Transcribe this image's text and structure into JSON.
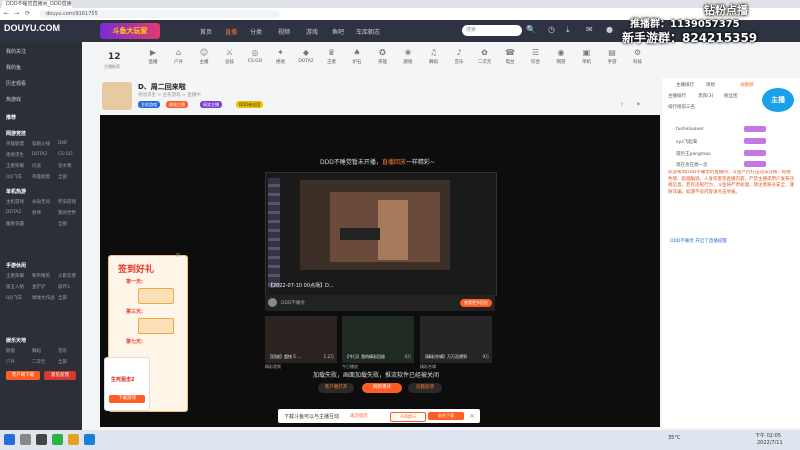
{
  "browser": {
    "tab_title": "DDD不睡觉直播间_DDD直播视频_斗鱼直播",
    "url": "douyu.com/9161755",
    "back": "←",
    "forward": "→",
    "refresh": "⟳"
  },
  "header": {
    "logo": "DOUYU.COM",
    "logo_sub": "斗鱼",
    "banner": "斗鱼大玩家",
    "nav": [
      "首页",
      "直播",
      "分类",
      "视频",
      "游戏",
      "鱼吧",
      "车库朝志"
    ],
    "active_nav": "直播",
    "search_placeholder": "搜索"
  },
  "sidebar": {
    "top_items": [
      "我的关注",
      "我的鱼",
      "历史观看",
      "热游戏"
    ],
    "recommend_label": "推荐",
    "sections": [
      {
        "title": "网游竞技",
        "cells": [
          "英雄联盟",
          "英雄联盟",
          "穿越火线",
          "DNF",
          "绝地求生",
          "DOTA2",
          "CS:GO",
          "王者荣耀",
          "问道",
          "逆水寒",
          "QQ飞车",
          "全部"
        ]
      },
      {
        "title": "单机热游",
        "cells": [
          "主机游戏",
          "永劫无间",
          "怀旧游戏",
          "DOTA2",
          "原神",
          "我的世界",
          "魔兽争霸",
          "全部"
        ]
      },
      {
        "title": "手游休闲",
        "cells": [
          "王者荣耀",
          "和平精英",
          "火影忍者",
          "第五人格",
          "金铲铲",
          "崩坏3",
          "QQ飞车",
          "球球大作战",
          "全部"
        ]
      },
      {
        "title": "娱乐天地",
        "cells": [
          "颜值",
          "舞蹈",
          "音乐",
          "户外",
          "二次元",
          "全部"
        ]
      },
      {
        "title": "科技文化",
        "cells": [
          "科技",
          "数码",
          "全部"
        ]
      }
    ],
    "btn_client": "客户端下载",
    "btn_feedback": "意见反馈"
  },
  "top_stats": {
    "count": "12",
    "label": "主播推荐"
  },
  "categories": [
    "直播",
    "户外",
    "主播",
    "竞技",
    "CS:GO",
    "绝地",
    "DOTA2",
    "王者",
    "炉石",
    "英雄",
    "颜值",
    "舞蹈",
    "音乐",
    "二次元",
    "电台",
    "综合",
    "网游",
    "单机",
    "手游",
    "科技"
  ],
  "streamer": {
    "title": "D、周二回来啦",
    "meta": "绝地求生 > 主机游戏 > 直播中",
    "tags": [
      {
        "label": "主机游戏",
        "color": "#2a6cd6"
      },
      {
        "label": "最强主播",
        "color": "#ff5d23"
      },
      {
        "label": "搞笑主播",
        "color": "#7a3fd6"
      },
      {
        "label": "DDD粉丝团",
        "color": "#f0c000"
      }
    ]
  },
  "player": {
    "banner_pre": "DDD不睡觉暂未开播，",
    "banner_hl": "直播回放",
    "banner_post": "一样精彩~",
    "video_label": "【2022-07-10 00点场】D...",
    "video_streamer": "DDD不睡觉",
    "video_btn": "查看更多回放",
    "thumbs": [
      {
        "caption": "【回放】超快 5 ...",
        "count": "1.2万",
        "name": "精彩视频"
      },
      {
        "caption": "【今日】我的精彩回放",
        "count": "4万",
        "name": "今日播放"
      },
      {
        "caption": "【精彩合辑】万万没想到",
        "count": "9万",
        "name": "精彩合辑"
      }
    ],
    "fail_text": "加载失败，画面加载失败，推流软件已经被关闭",
    "btn_client": "客户端打开",
    "btn_retry": "刷新重试",
    "btn_report": "问题反馈"
  },
  "toast": {
    "text": "下载斗鱼可以与主播互动",
    "link": "再次提示",
    "btn_cancel": "不再提示",
    "btn_go": "前往下载"
  },
  "promo": {
    "title": "签到好礼",
    "day1": "第一天:",
    "day3": "第三天:",
    "day7": "第七天:",
    "ad_text": "生死狙击2",
    "ad_btn": "下载游戏"
  },
  "right_panel": {
    "header_items": [
      "主播排行",
      "周榜",
      "贡献榜"
    ],
    "tabs": [
      "主播排行",
      "贵宾(3)",
      "粉丝团"
    ],
    "rank_label": "排行榜前三名",
    "users": [
      "fusheliuaoer",
      "xyz飞起来",
      "冒险王pangmao",
      "现在也在想一念"
    ],
    "notice": "欢迎来到DDD不睡觉的直播间，斗鱼严厉打击违法违规、低俗色情、吸烟酗酒、人身伤害等直播内容，严禁主播或用户发布违规信息，若有违规行为，斗鱼将严肃处理。请注意账号安全，谨防诈骗，如遇不良内容请点击举报。",
    "system": "DDD不睡觉 开启了直播提醒"
  },
  "overlay": {
    "top_right": "钻粉点播",
    "line1": "推播群：1139057375",
    "line2": "新手游群：824215359",
    "badge": "主播"
  },
  "taskbar": {
    "clock": "下午 02:05",
    "date": "2022/7/11",
    "temp": "35°C"
  },
  "colors": {
    "accent": "#ff5d23",
    "header_bg": "#2d3340",
    "sidebar_bg": "#2b2f38"
  }
}
